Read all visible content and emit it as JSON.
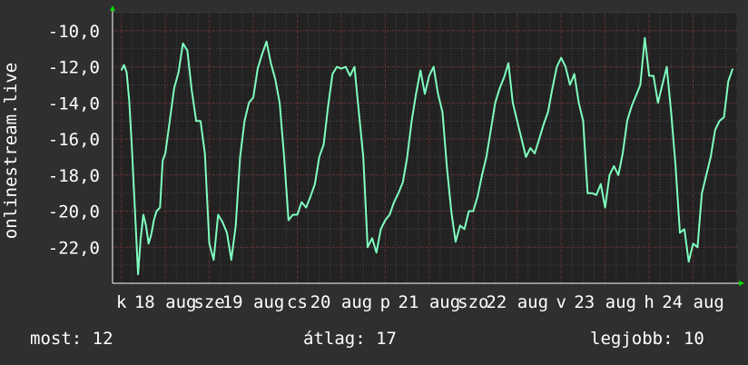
{
  "chart_data": {
    "type": "line",
    "ylabel": "onlinestream.live",
    "ylim": [
      -24,
      -9
    ],
    "yticks": [
      -10,
      -12,
      -14,
      -16,
      -18,
      -20,
      -22
    ],
    "ytick_labels": [
      "-10,0",
      "-12,0",
      "-14,0",
      "-16,0",
      "-18,0",
      "-20,0",
      "-22,0"
    ],
    "xlim": [
      -0.1,
      7.0
    ],
    "xticks": [
      {
        "x": 0.0,
        "label": "k"
      },
      {
        "x": 0.5,
        "label": "18 aug"
      },
      {
        "x": 1.0,
        "label": "sze"
      },
      {
        "x": 1.5,
        "label": "19 aug"
      },
      {
        "x": 2.0,
        "label": "cs"
      },
      {
        "x": 2.5,
        "label": "20 aug"
      },
      {
        "x": 3.0,
        "label": "p"
      },
      {
        "x": 3.5,
        "label": "21 aug"
      },
      {
        "x": 4.0,
        "label": "szo"
      },
      {
        "x": 4.5,
        "label": "22 aug"
      },
      {
        "x": 5.0,
        "label": "v"
      },
      {
        "x": 5.5,
        "label": "23 aug"
      },
      {
        "x": 6.0,
        "label": "h"
      },
      {
        "x": 6.5,
        "label": "24 aug"
      }
    ],
    "grid": true,
    "series": [
      {
        "color": "#7fffbf",
        "x": [
          0.0,
          0.03,
          0.06,
          0.09,
          0.12,
          0.16,
          0.19,
          0.22,
          0.25,
          0.28,
          0.31,
          0.34,
          0.37,
          0.4,
          0.44,
          0.47,
          0.5,
          0.55,
          0.6,
          0.65,
          0.7,
          0.75,
          0.8,
          0.85,
          0.9,
          0.95,
          1.0,
          1.05,
          1.1,
          1.15,
          1.2,
          1.25,
          1.3,
          1.35,
          1.4,
          1.45,
          1.5,
          1.55,
          1.6,
          1.65,
          1.7,
          1.75,
          1.8,
          1.85,
          1.9,
          1.95,
          2.0,
          2.05,
          2.1,
          2.15,
          2.2,
          2.25,
          2.3,
          2.35,
          2.4,
          2.45,
          2.5,
          2.55,
          2.6,
          2.65,
          2.7,
          2.75,
          2.8,
          2.85,
          2.9,
          2.95,
          3.0,
          3.05,
          3.1,
          3.15,
          3.2,
          3.25,
          3.3,
          3.35,
          3.4,
          3.45,
          3.5,
          3.55,
          3.6,
          3.65,
          3.7,
          3.75,
          3.8,
          3.85,
          3.9,
          3.95,
          4.0,
          4.05,
          4.1,
          4.15,
          4.2,
          4.25,
          4.3,
          4.35,
          4.4,
          4.45,
          4.5,
          4.55,
          4.6,
          4.65,
          4.7,
          4.75,
          4.8,
          4.85,
          4.9,
          4.95,
          5.0,
          5.05,
          5.1,
          5.15,
          5.2,
          5.25,
          5.3,
          5.35,
          5.4,
          5.45,
          5.5,
          5.55,
          5.6,
          5.65,
          5.7,
          5.75,
          5.8,
          5.85,
          5.9,
          5.95,
          6.0,
          6.05,
          6.1,
          6.15,
          6.2,
          6.25,
          6.3,
          6.35,
          6.4,
          6.45,
          6.5,
          6.55,
          6.6,
          6.65,
          6.7,
          6.75,
          6.8,
          6.85,
          6.9,
          6.95
        ],
        "values": [
          -12.2,
          -11.9,
          -12.3,
          -13.9,
          -16.5,
          -20.5,
          -23.5,
          -21.5,
          -20.2,
          -20.8,
          -21.8,
          -21.3,
          -20.5,
          -20.0,
          -19.8,
          -17.2,
          -16.8,
          -15.0,
          -13.2,
          -12.3,
          -10.7,
          -11.1,
          -13.3,
          -15.0,
          -15.0,
          -16.8,
          -21.8,
          -22.7,
          -20.2,
          -20.6,
          -21.2,
          -22.7,
          -20.8,
          -17.0,
          -15.0,
          -14.0,
          -13.7,
          -12.1,
          -11.3,
          -10.6,
          -11.8,
          -12.7,
          -14.0,
          -17.0,
          -20.5,
          -20.2,
          -20.2,
          -19.5,
          -19.8,
          -19.2,
          -18.5,
          -17.0,
          -16.3,
          -14.2,
          -12.4,
          -12.0,
          -12.1,
          -12.0,
          -12.5,
          -12.0,
          -14.5,
          -17.0,
          -22.0,
          -21.5,
          -22.3,
          -21.0,
          -20.5,
          -20.2,
          -19.5,
          -19.0,
          -18.4,
          -17.0,
          -15.0,
          -13.5,
          -12.2,
          -13.5,
          -12.5,
          -12.0,
          -13.5,
          -14.5,
          -17.5,
          -20.0,
          -21.7,
          -20.8,
          -21.0,
          -20.0,
          -20.0,
          -19.2,
          -18.0,
          -17.0,
          -15.5,
          -14.0,
          -13.2,
          -12.6,
          -11.8,
          -14.0,
          -15.0,
          -16.0,
          -17.0,
          -16.5,
          -16.8,
          -16.0,
          -15.2,
          -14.5,
          -13.2,
          -12.0,
          -11.5,
          -12.0,
          -13.0,
          -12.4,
          -14.0,
          -15.0,
          -19.0,
          -19.0,
          -19.1,
          -18.5,
          -19.8,
          -18.0,
          -17.5,
          -18.0,
          -16.8,
          -15.0,
          -14.2,
          -13.6,
          -13.0,
          -10.4,
          -12.5,
          -12.5,
          -14.0,
          -13.0,
          -12.0,
          -14.5,
          -17.5,
          -21.2,
          -21.0,
          -22.8,
          -21.8,
          -22.0,
          -19.0,
          -18.0,
          -17.0,
          -15.5,
          -15.0,
          -14.8,
          -12.8,
          -12.1
        ]
      }
    ]
  },
  "stats": {
    "current": "most: 12",
    "average": "átlag: 17",
    "max": "legjobb: 10"
  },
  "colors": {
    "background": "#2f2f2f",
    "plot_background": "#222222",
    "line": "#7fffbf",
    "grid_major": "#6b2b2b",
    "grid_minor": "#4a4a4a",
    "axis": "#ffffff",
    "arrow": "#00dd00"
  }
}
